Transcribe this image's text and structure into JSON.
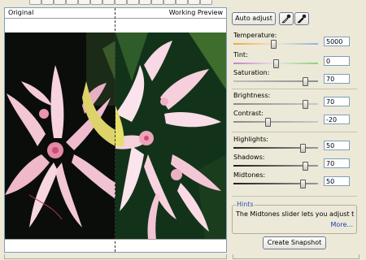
{
  "viewer": {
    "label_left": "Original",
    "label_right": "Working Preview"
  },
  "toolbar": {
    "auto_adjust_label": "Auto adjust"
  },
  "sliders": [
    {
      "id": "temperature",
      "label": "Temperature:",
      "value": "5000",
      "position": 0.47,
      "track": "temp"
    },
    {
      "id": "tint",
      "label": "Tint:",
      "value": "0",
      "position": 0.5,
      "track": "tint"
    },
    {
      "id": "saturation",
      "label": "Saturation:",
      "value": "70",
      "position": 0.85,
      "track": "plain"
    },
    {
      "id": "brightness",
      "label": "Brightness:",
      "value": "70",
      "position": 0.85,
      "track": "plain"
    },
    {
      "id": "contrast",
      "label": "Contrast:",
      "value": "-20",
      "position": 0.4,
      "track": "plain"
    },
    {
      "id": "highlights",
      "label": "Highlights:",
      "value": "50",
      "position": 0.82,
      "track": "dark"
    },
    {
      "id": "shadows",
      "label": "Shadows:",
      "value": "70",
      "position": 0.85,
      "track": "dark"
    },
    {
      "id": "midtones",
      "label": "Midtones:",
      "value": "50",
      "position": 0.82,
      "track": "dark"
    }
  ],
  "hints": {
    "title": "Hints",
    "text": "The Midtones slider lets you adjust the",
    "more_label": "More..."
  },
  "snapshot_button_label": "Create Snapshot",
  "icons": {
    "eyedropper_white": "eyedropper-icon",
    "eyedropper_black": "eyedropper-icon"
  }
}
